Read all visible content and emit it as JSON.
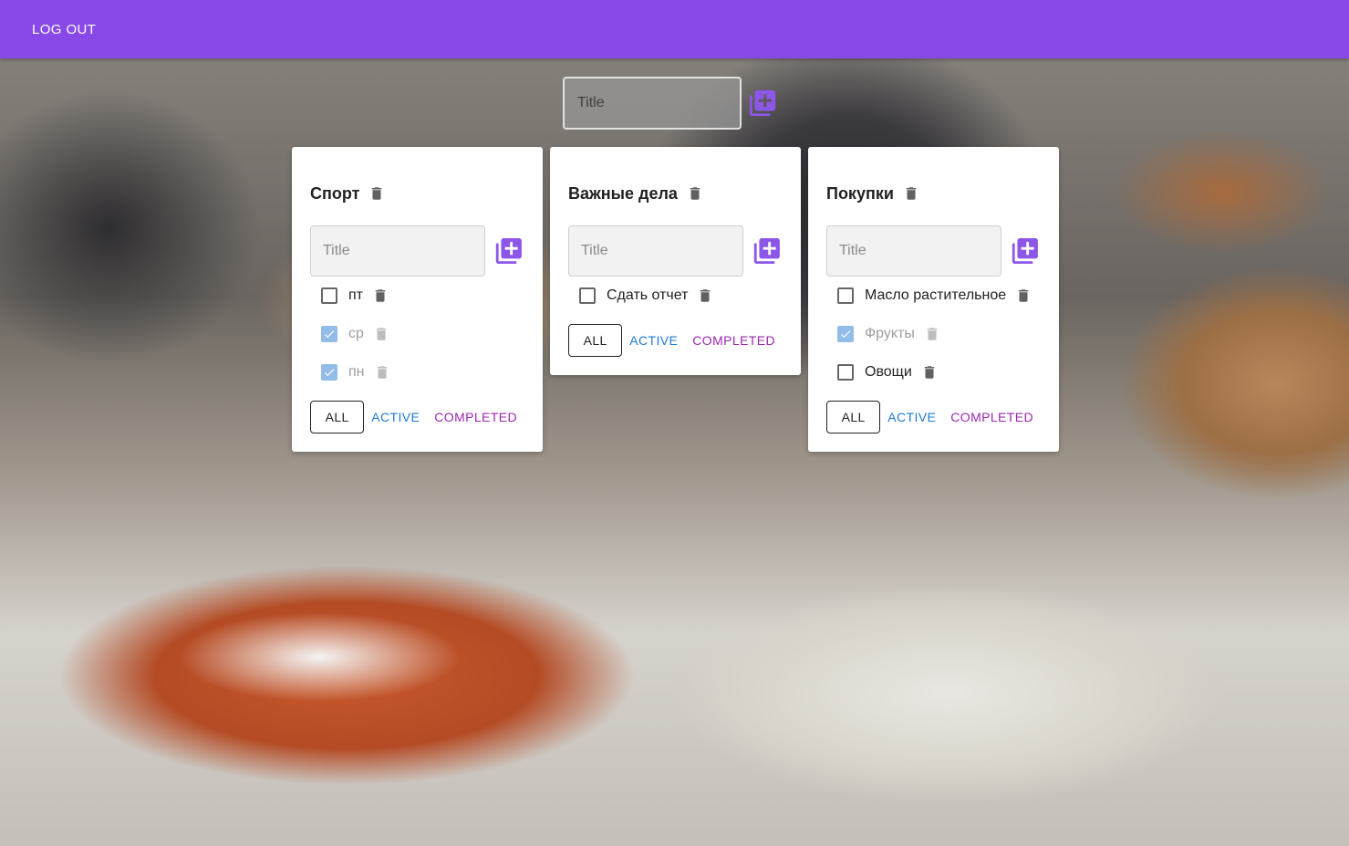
{
  "appbar": {
    "logout_label": "LOG OUT",
    "color": "#8849e8"
  },
  "add_list": {
    "placeholder": "Title",
    "add_icon": "add-box-multiple-icon"
  },
  "accent": {
    "icon": "#8c57e6",
    "active": "#1e7ad6",
    "completed": "#9c27b0",
    "checked": "#93bde8"
  },
  "filters": {
    "all": "ALL",
    "active": "ACTIVE",
    "completed": "COMPLETED"
  },
  "lists": [
    {
      "title": "Спорт",
      "input_placeholder": "Title",
      "tasks": [
        {
          "label": "пт",
          "done": false
        },
        {
          "label": "ср",
          "done": true
        },
        {
          "label": "пн",
          "done": true
        }
      ]
    },
    {
      "title": "Важные дела",
      "input_placeholder": "Title",
      "tasks": [
        {
          "label": "Сдать отчет",
          "done": false
        }
      ]
    },
    {
      "title": "Покупки",
      "input_placeholder": "Title",
      "tasks": [
        {
          "label": "Масло растительное",
          "done": false
        },
        {
          "label": "Фрукты",
          "done": true
        },
        {
          "label": "Овощи",
          "done": false
        }
      ]
    }
  ]
}
